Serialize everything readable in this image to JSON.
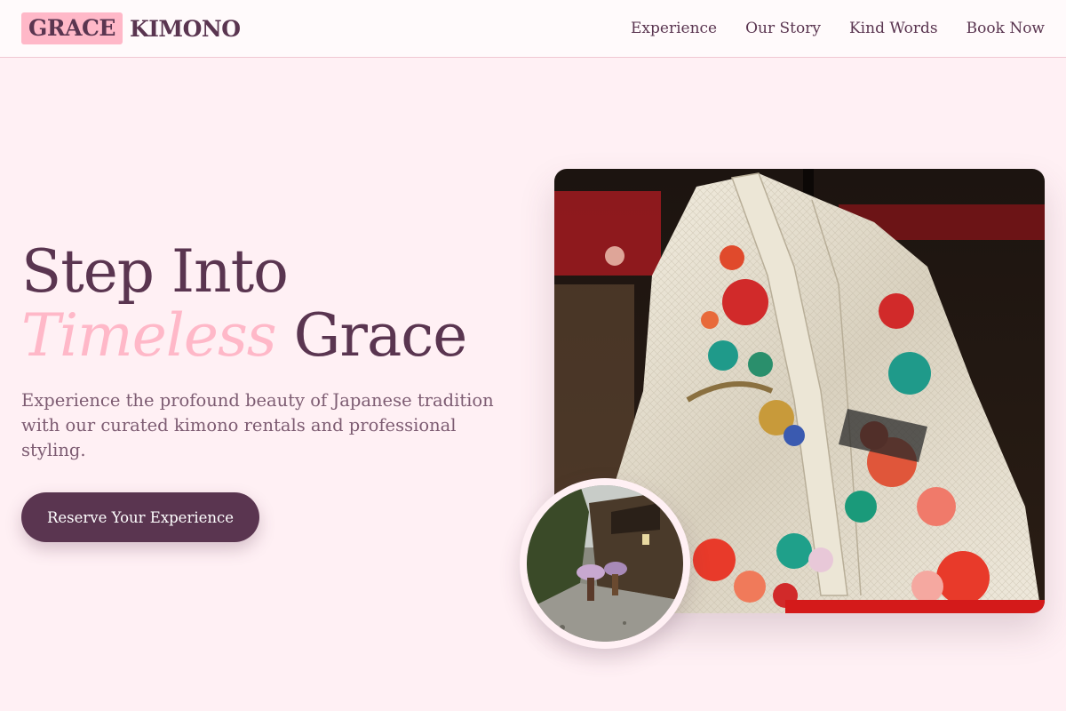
{
  "header": {
    "logo_highlight": "GRACE",
    "logo_text": "KIMONO",
    "nav": [
      {
        "label": "Experience"
      },
      {
        "label": "Our Story"
      },
      {
        "label": "Kind Words"
      },
      {
        "label": "Book Now"
      }
    ]
  },
  "hero": {
    "title_line1": "Step Into",
    "title_accent": "Timeless",
    "title_line2_rest": "Grace",
    "description": "Experience the profound beauty of Japanese tradition with our curated kimono rentals and professional styling.",
    "cta_label": "Reserve Your Experience"
  },
  "images": {
    "main_alt": "White silk kimono with red and green floral embroidery",
    "secondary_alt": "Two women in kimono with umbrellas walking on a rainy old street"
  },
  "colors": {
    "background": "#fff0f4",
    "primary": "#5a3550",
    "accent_pink": "#ffb8c8",
    "text_muted": "#7d5c72"
  }
}
